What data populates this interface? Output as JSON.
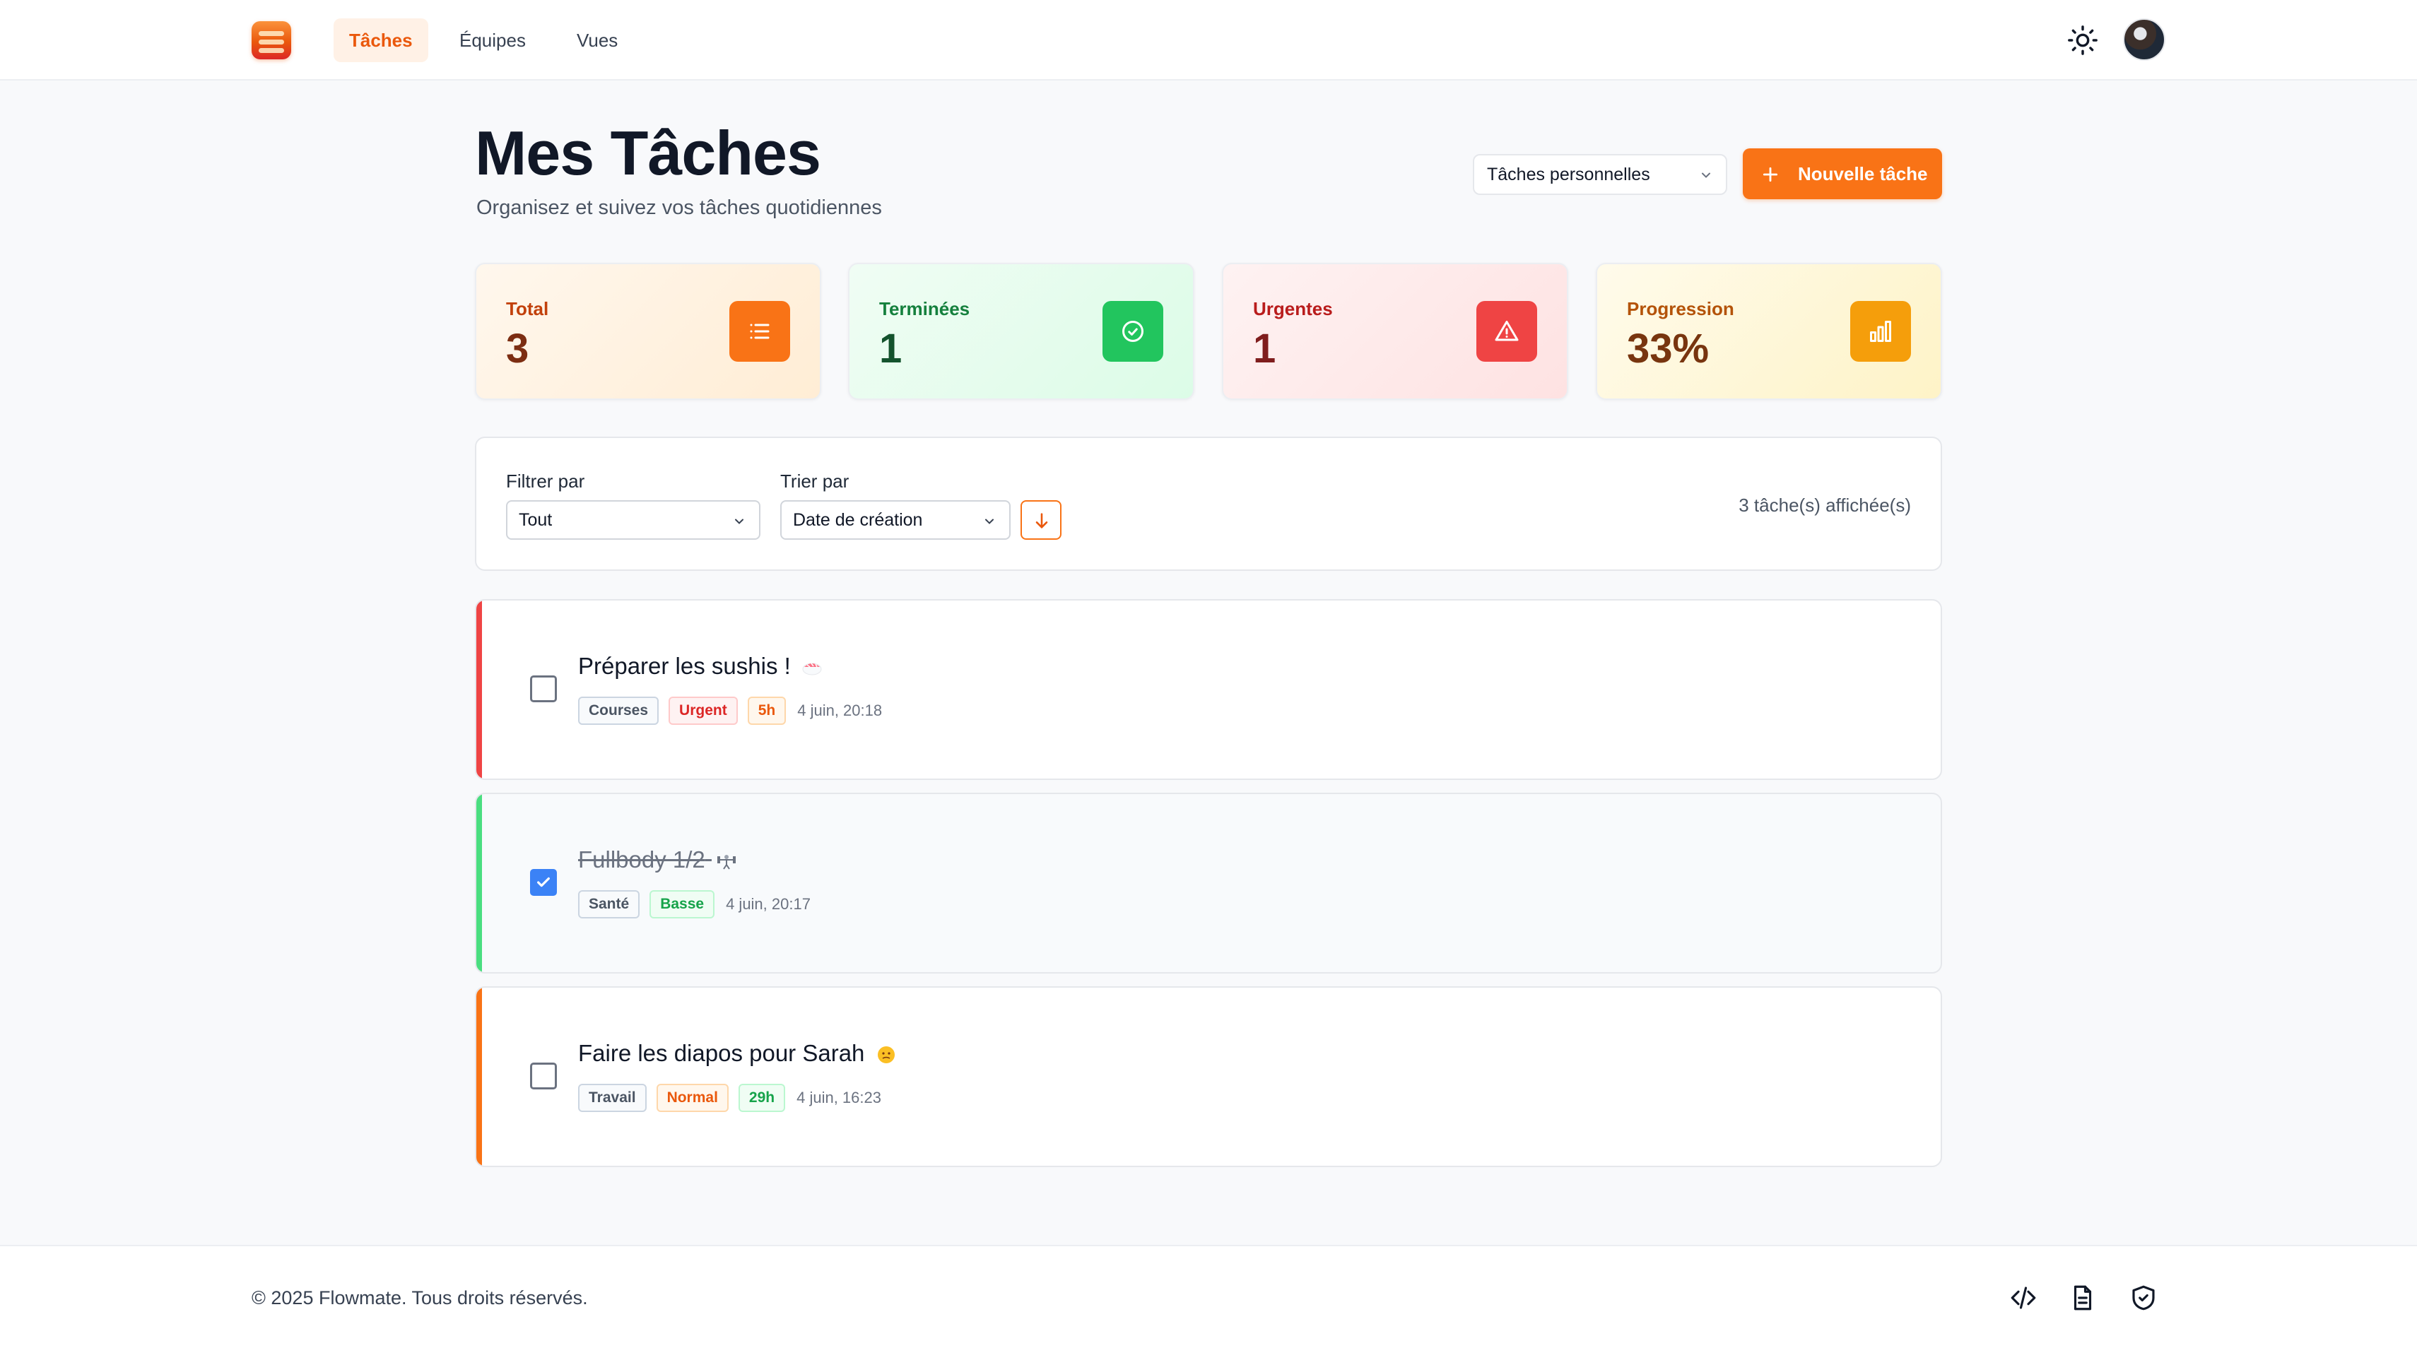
{
  "nav": {
    "items": [
      {
        "label": "Tâches",
        "active": true
      },
      {
        "label": "Équipes",
        "active": false
      },
      {
        "label": "Vues",
        "active": false
      }
    ]
  },
  "header_icons": [
    "logo-icon",
    "sun-icon",
    "avatar"
  ],
  "page": {
    "title": "Mes Tâches",
    "subtitle": "Organisez et suivez vos tâches quotidiennes",
    "scope_select": "Tâches personnelles",
    "new_task_label": "Nouvelle tâche"
  },
  "stats": [
    {
      "label": "Total",
      "value": "3",
      "icon": "list-icon",
      "color": "#f97316"
    },
    {
      "label": "Terminées",
      "value": "1",
      "icon": "check-circle-icon",
      "color": "#22c55e"
    },
    {
      "label": "Urgentes",
      "value": "1",
      "icon": "alert-triangle-icon",
      "color": "#ef4444"
    },
    {
      "label": "Progression",
      "value": "33%",
      "icon": "bar-chart-icon",
      "color": "#f59e0b"
    }
  ],
  "filters": {
    "filter_label": "Filtrer par",
    "filter_value": "Tout",
    "sort_label": "Trier par",
    "sort_value": "Date de création",
    "sort_direction": "descending",
    "count_text": "3 tâche(s) affichée(s)"
  },
  "tasks": [
    {
      "title": "Préparer les sushis !",
      "emoji": "sushi",
      "done": false,
      "accent": "#ef4444",
      "category": "Courses",
      "priority": "Urgent",
      "time": "5h",
      "date": "4 juin, 20:18"
    },
    {
      "title": "Fullbody 1/2",
      "emoji": "weightlifter",
      "done": true,
      "accent": "#4ade80",
      "category": "Santé",
      "priority": "Basse",
      "time": "",
      "date": "4 juin, 20:17"
    },
    {
      "title": "Faire les diapos pour Sarah",
      "emoji": "face",
      "done": false,
      "accent": "#f97316",
      "category": "Travail",
      "priority": "Normal",
      "time": "29h",
      "date": "4 juin, 16:23"
    }
  ],
  "footer": {
    "copyright": "© 2025 Flowmate. Tous droits réservés.",
    "icons": [
      "code-icon",
      "document-icon",
      "shield-check-icon"
    ]
  }
}
